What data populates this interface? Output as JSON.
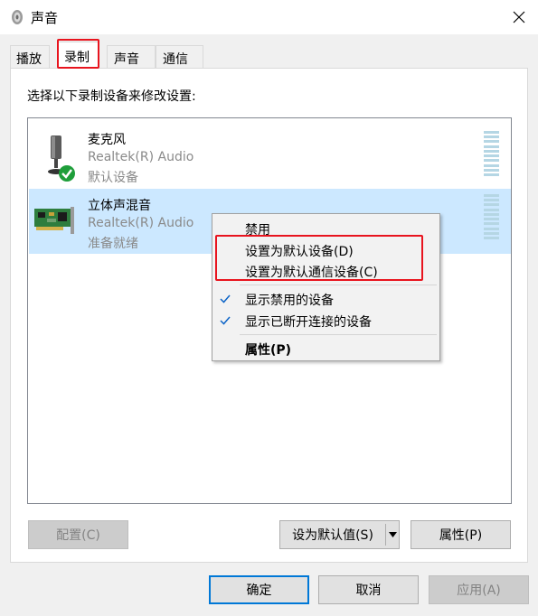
{
  "window": {
    "title": "声音"
  },
  "tabs": [
    {
      "label": "播放",
      "active": false
    },
    {
      "label": "录制",
      "active": true
    },
    {
      "label": "声音",
      "active": false
    },
    {
      "label": "通信",
      "active": false
    }
  ],
  "panel": {
    "instructions": "选择以下录制设备来修改设置:"
  },
  "devices": [
    {
      "name": "麦克风",
      "driver": "Realtek(R) Audio",
      "status": "默认设备",
      "icon": "microphone-icon",
      "is_default": true,
      "selected": false
    },
    {
      "name": "立体声混音",
      "driver": "Realtek(R) Audio",
      "status": "准备就绪",
      "icon": "sound-card-icon",
      "is_default": false,
      "selected": true
    }
  ],
  "context_menu": {
    "items": [
      {
        "label": "禁用",
        "checked": false,
        "bold": false
      },
      {
        "label": "设置为默认设备(D)",
        "checked": false,
        "bold": false
      },
      {
        "label": "设置为默认通信设备(C)",
        "checked": false,
        "bold": false
      },
      {
        "label": "显示禁用的设备",
        "checked": true,
        "bold": false
      },
      {
        "label": "显示已断开连接的设备",
        "checked": true,
        "bold": false
      },
      {
        "label": "属性(P)",
        "checked": false,
        "bold": true
      }
    ]
  },
  "panel_buttons": {
    "configure": "配置(C)",
    "set_default": "设为默认值(S)",
    "properties": "属性(P)"
  },
  "dialog_buttons": {
    "ok": "确定",
    "cancel": "取消",
    "apply": "应用(A)"
  },
  "colors": {
    "selection": "#cce8ff",
    "annotation_red": "#e8141e",
    "default_check_green": "#1e9e3a",
    "accent_blue": "#0078d7"
  }
}
